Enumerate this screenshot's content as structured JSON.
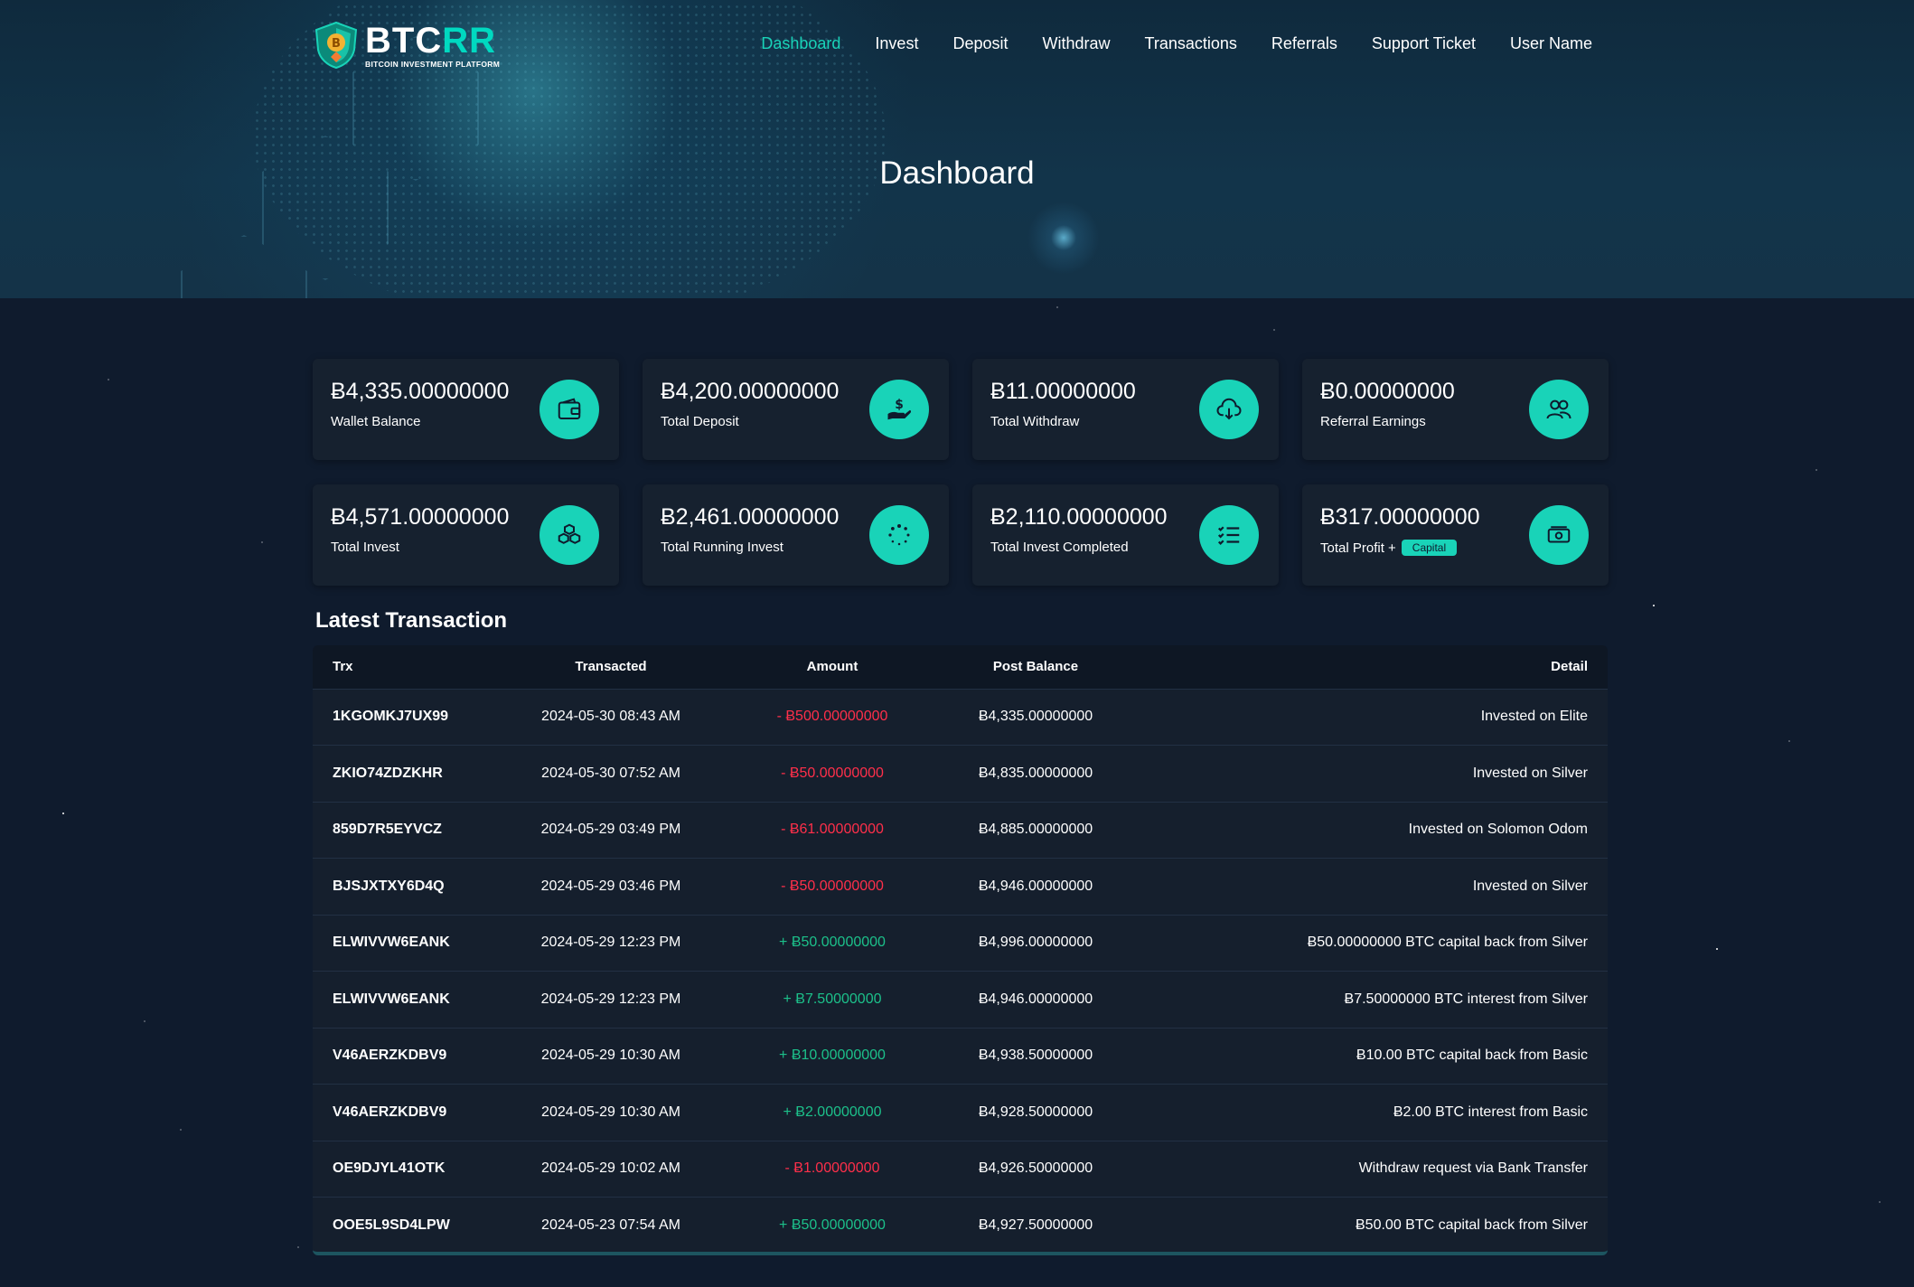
{
  "header": {
    "brand_main": "BTC",
    "brand_accent": "RR",
    "brand_tagline": "BITCOIN INVESTMENT PLATFORM",
    "logo_symbol": "B",
    "nav": [
      {
        "label": "Dashboard",
        "active": true
      },
      {
        "label": "Invest"
      },
      {
        "label": "Deposit"
      },
      {
        "label": "Withdraw"
      },
      {
        "label": "Transactions"
      },
      {
        "label": "Referrals"
      },
      {
        "label": "Support Ticket"
      },
      {
        "label": "User Name"
      }
    ]
  },
  "page_title": "Dashboard",
  "cards": [
    {
      "value": "Ƀ4,335.00000000",
      "label": "Wallet Balance",
      "icon": "wallet-icon"
    },
    {
      "value": "Ƀ4,200.00000000",
      "label": "Total Deposit",
      "icon": "hand-dollar-icon"
    },
    {
      "value": "Ƀ11.00000000",
      "label": "Total Withdraw",
      "icon": "cloud-download-icon"
    },
    {
      "value": "Ƀ0.00000000",
      "label": "Referral Earnings",
      "icon": "users-icon"
    },
    {
      "value": "Ƀ4,571.00000000",
      "label": "Total Invest",
      "icon": "cubes-icon"
    },
    {
      "value": "Ƀ2,461.00000000",
      "label": "Total Running Invest",
      "icon": "spinner-icon"
    },
    {
      "value": "Ƀ2,110.00000000",
      "label": "Total Invest Completed",
      "icon": "list-check-icon"
    },
    {
      "value": "Ƀ317.00000000",
      "label": "Total Profit +",
      "badge": "Capital",
      "icon": "money-bill-icon"
    }
  ],
  "transactions": {
    "title": "Latest Transaction",
    "columns": [
      "Trx",
      "Transacted",
      "Amount",
      "Post Balance",
      "Detail"
    ],
    "rows": [
      {
        "trx": "1KGOMKJ7UX99",
        "date": "2024-05-30 08:43 AM",
        "amount": "- Ƀ500.00000000",
        "type": "neg",
        "balance": "Ƀ4,335.00000000",
        "detail": "Invested on Elite"
      },
      {
        "trx": "ZKIO74ZDZKHR",
        "date": "2024-05-30 07:52 AM",
        "amount": "- Ƀ50.00000000",
        "type": "neg",
        "balance": "Ƀ4,835.00000000",
        "detail": "Invested on Silver"
      },
      {
        "trx": "859D7R5EYVCZ",
        "date": "2024-05-29 03:49 PM",
        "amount": "- Ƀ61.00000000",
        "type": "neg",
        "balance": "Ƀ4,885.00000000",
        "detail": "Invested on Solomon Odom"
      },
      {
        "trx": "BJSJXTXY6D4Q",
        "date": "2024-05-29 03:46 PM",
        "amount": "- Ƀ50.00000000",
        "type": "neg",
        "balance": "Ƀ4,946.00000000",
        "detail": "Invested on Silver"
      },
      {
        "trx": "ELWIVVW6EANK",
        "date": "2024-05-29 12:23 PM",
        "amount": "+ Ƀ50.00000000",
        "type": "pos",
        "balance": "Ƀ4,996.00000000",
        "detail": "Ƀ50.00000000 BTC capital back from Silver"
      },
      {
        "trx": "ELWIVVW6EANK",
        "date": "2024-05-29 12:23 PM",
        "amount": "+ Ƀ7.50000000",
        "type": "pos",
        "balance": "Ƀ4,946.00000000",
        "detail": "Ƀ7.50000000 BTC interest from Silver"
      },
      {
        "trx": "V46AERZKDBV9",
        "date": "2024-05-29 10:30 AM",
        "amount": "+ Ƀ10.00000000",
        "type": "pos",
        "balance": "Ƀ4,938.50000000",
        "detail": "Ƀ10.00 BTC capital back from Basic"
      },
      {
        "trx": "V46AERZKDBV9",
        "date": "2024-05-29 10:30 AM",
        "amount": "+ Ƀ2.00000000",
        "type": "pos",
        "balance": "Ƀ4,928.50000000",
        "detail": "Ƀ2.00 BTC interest from Basic"
      },
      {
        "trx": "OE9DJYL41OTK",
        "date": "2024-05-29 10:02 AM",
        "amount": "- Ƀ1.00000000",
        "type": "neg",
        "balance": "Ƀ4,926.50000000",
        "detail": "Withdraw request via Bank Transfer"
      },
      {
        "trx": "OOE5L9SD4LPW",
        "date": "2024-05-23 07:54 AM",
        "amount": "+ Ƀ50.00000000",
        "type": "pos",
        "balance": "Ƀ4,927.50000000",
        "detail": "Ƀ50.00 BTC capital back from Silver"
      }
    ]
  },
  "colors": {
    "accent": "#19d3b8",
    "background": "#0f1b2d",
    "card": "#16212f",
    "negative": "#ff2f4a",
    "positive": "#1cc08a"
  }
}
